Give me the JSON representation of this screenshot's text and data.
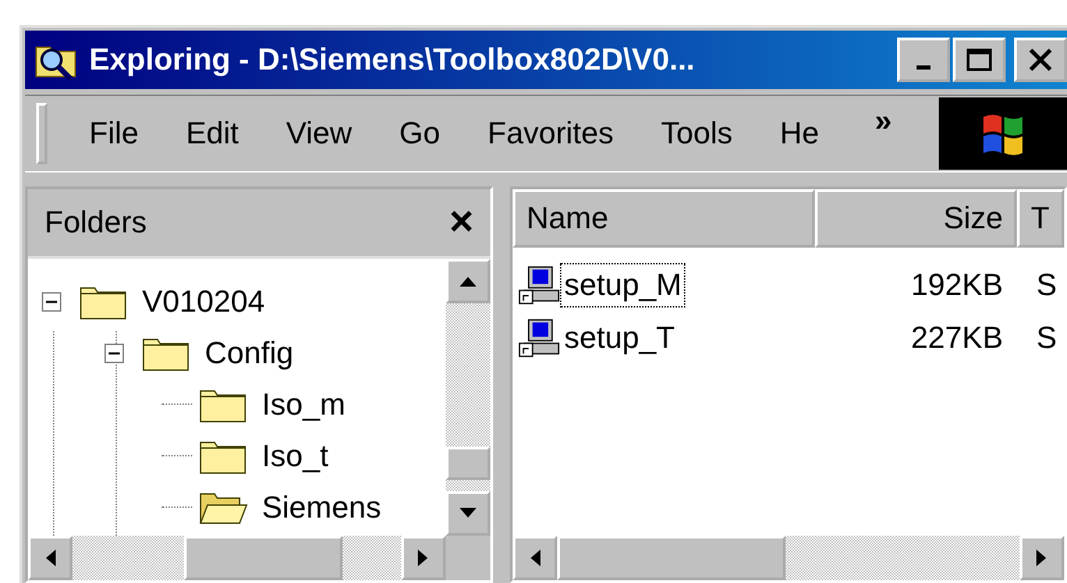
{
  "window": {
    "title": "Exploring - D:\\Siemens\\Toolbox802D\\V0..."
  },
  "menu": [
    {
      "label": "File"
    },
    {
      "label": "Edit"
    },
    {
      "label": "View"
    },
    {
      "label": "Go"
    },
    {
      "label": "Favorites"
    },
    {
      "label": "Tools"
    },
    {
      "label": "He"
    }
  ],
  "menu_overflow": "»",
  "folders": {
    "title": "Folders",
    "close": "×",
    "tree": [
      {
        "label": "V010204",
        "expanded": true,
        "open": false,
        "children": [
          {
            "label": "Config",
            "expanded": true,
            "open": false,
            "children": [
              {
                "label": "Iso_m",
                "open": false
              },
              {
                "label": "Iso_t",
                "open": false
              },
              {
                "label": "Siemens",
                "open": true
              }
            ]
          }
        ]
      }
    ]
  },
  "files": {
    "columns": [
      "Name",
      "Size",
      "T"
    ],
    "rows": [
      {
        "name": "setup_M",
        "size": "192KB",
        "column_3": "S",
        "focused": true
      },
      {
        "name": "setup_T",
        "size": "227KB",
        "column_3": "S",
        "focused": false
      }
    ]
  }
}
